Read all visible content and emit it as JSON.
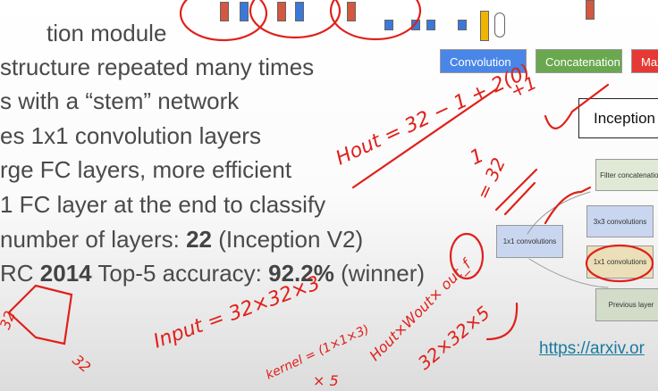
{
  "slide": {
    "bullets": [
      {
        "text": "tion module"
      },
      {
        "text": " structure repeated many times"
      },
      {
        "text": "s with a “stem” network"
      },
      {
        "text": "es 1x1 convolution layers"
      },
      {
        "text": "rge FC layers, more efficient"
      },
      {
        "text": "1 FC layer at the end to classify"
      },
      {
        "pre": "number of layers: ",
        "bold": "22",
        "post": " (Inception V2)"
      },
      {
        "pre": "RC ",
        "bold": "2014",
        "mid": " Top-5 accuracy: ",
        "bold2": "92.2%",
        "post": " (winner)"
      }
    ],
    "legend": {
      "convolution": "Convolution",
      "concatenation": "Concatenation",
      "maxpool": "Max"
    },
    "inception_title": "Inception",
    "diagram": {
      "filter_concat": "Filter concatenation",
      "conv3x3": "3x3 convolutions",
      "conv1x1_left": "1x1 convolutions",
      "conv1x1_mid": "1x1 convolutions",
      "previous": "Previous layer"
    },
    "link": "https://arxiv.or"
  },
  "annotations": {
    "formula_top": "Hout = 32 − 1 + 2(0)",
    "plus_one": "+1",
    "denominator": "1",
    "equals": "= 32",
    "input": "Input = 32×32×3",
    "kernel": "kernel = (1×1×3)",
    "times5": "× 5",
    "output": "Hout×Wout× out_f",
    "output_value": "32×32×5",
    "side1": "32",
    "side2": "32"
  },
  "colors": {
    "convolution": "#4a86e8",
    "concatenation": "#6aa84f",
    "maxpool": "#e53935",
    "ink": "#e0201a"
  }
}
